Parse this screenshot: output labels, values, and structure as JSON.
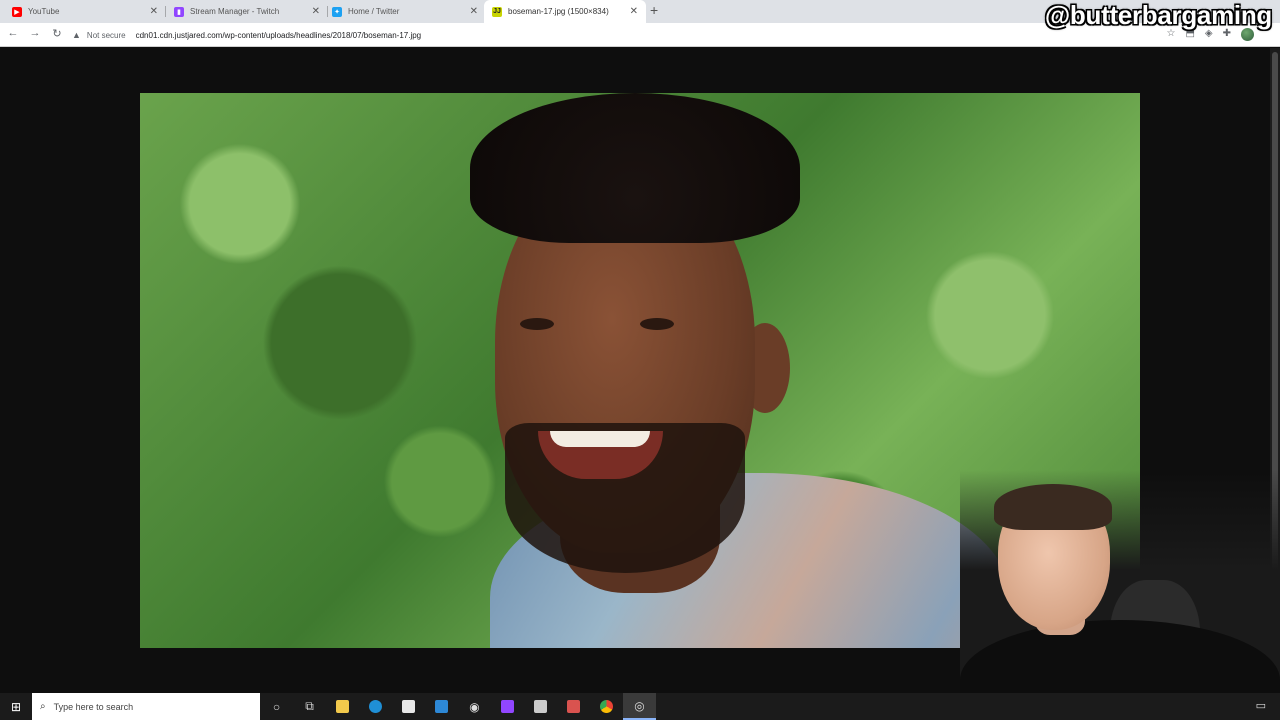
{
  "browser": {
    "tabs": [
      {
        "label": "YouTube",
        "favicon": "youtube-icon",
        "color": "#ff0000",
        "active": false
      },
      {
        "label": "Stream Manager - Twitch",
        "favicon": "twitch-icon",
        "color": "#9146ff",
        "active": false
      },
      {
        "label": "Home / Twitter",
        "favicon": "twitter-icon",
        "color": "#1da1f2",
        "active": false
      },
      {
        "label": "boseman-17.jpg (1500×834)",
        "favicon": "justjared-icon",
        "color": "#c8d400",
        "favicon_text": "JJ",
        "active": true
      }
    ],
    "address": {
      "security_label": "Not secure",
      "url": "cdn01.cdn.justjared.com/wp-content/uploads/headlines/2018/07/boseman-17.jpg"
    }
  },
  "overlay": {
    "handle": "@butterbargaming"
  },
  "page": {
    "image_alt": "photo of smiling man in front of green hedge",
    "background_color": "#0e0e0e"
  },
  "taskbar": {
    "search_placeholder": "Type here to search",
    "apps": [
      {
        "name": "cortana-icon",
        "glyph": "○"
      },
      {
        "name": "task-view-icon",
        "glyph": "⧉"
      },
      {
        "name": "file-explorer-icon",
        "color": "#f2c94c"
      },
      {
        "name": "edge-icon",
        "color": "#1f8fd6"
      },
      {
        "name": "store-icon",
        "color": "#e8e8e8"
      },
      {
        "name": "mail-icon",
        "color": "#2d88d6"
      },
      {
        "name": "obs-icon",
        "glyph": "◉"
      },
      {
        "name": "twitch-app-icon",
        "color": "#9146ff"
      },
      {
        "name": "notes-icon",
        "color": "#cccccc"
      },
      {
        "name": "capture-icon",
        "color": "#d9534f"
      },
      {
        "name": "chrome-icon",
        "color": "#4caf50"
      },
      {
        "name": "streaming-app-icon",
        "glyph": "◎",
        "active": true
      }
    ]
  }
}
